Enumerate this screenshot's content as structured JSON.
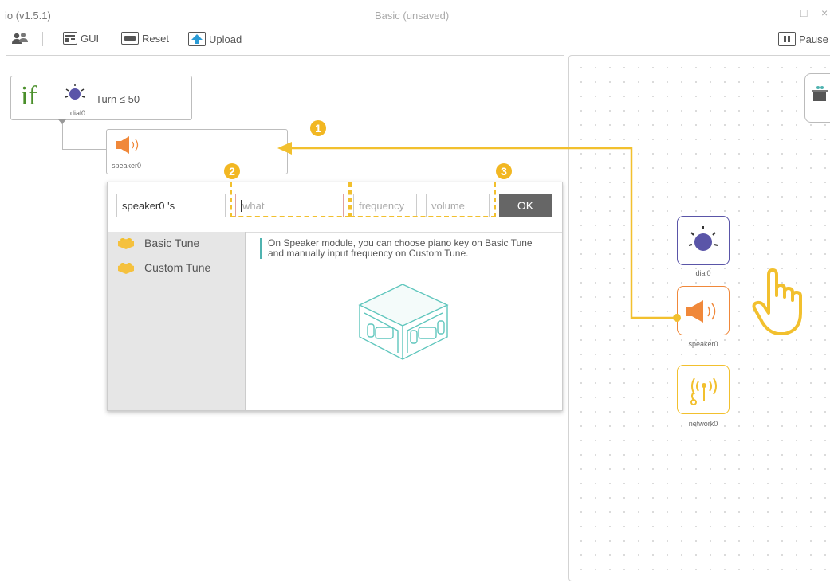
{
  "window": {
    "app_title": "io (v1.5.1)",
    "doc_title": "Basic (unsaved)",
    "minimize": "—",
    "maximize": "□",
    "close": "×"
  },
  "toolbar": {
    "gui_label": "GUI",
    "reset_label": "Reset",
    "upload_label": "Upload",
    "pause_label": "Pause"
  },
  "canvas": {
    "if_keyword": "if",
    "dial_label": "dial0",
    "condition": "Turn  ≤  50",
    "speaker_label": "speaker0"
  },
  "dialog": {
    "module_field": "speaker0 's",
    "what_placeholder": "what",
    "frequency_placeholder": "frequency",
    "volume_placeholder": "volume",
    "ok_label": "OK",
    "menu": [
      {
        "label": "Basic Tune"
      },
      {
        "label": "Custom Tune"
      }
    ],
    "description": "On Speaker module, you can choose piano key on Basic Tune and manually input frequency on Custom Tune."
  },
  "badges": [
    "1",
    "2",
    "3"
  ],
  "modules": [
    {
      "label": "dial0",
      "color": "#5a55a8"
    },
    {
      "label": "speaker0",
      "color": "#f0883a"
    },
    {
      "label": "network0",
      "color": "#f2c02e"
    }
  ],
  "colors": {
    "annotation": "#f2c02e",
    "dial": "#5a55a8",
    "speaker": "#f0883a",
    "network": "#f2c02e",
    "ok_button": "#666666"
  }
}
